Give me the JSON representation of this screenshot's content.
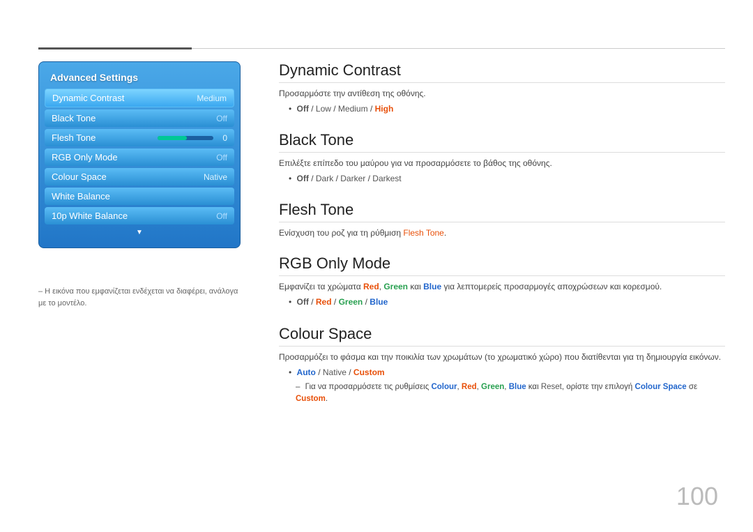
{
  "top": {
    "line_dark_label": "",
    "line_light_label": ""
  },
  "sidebar": {
    "title": "Advanced Settings",
    "items": [
      {
        "label": "Dynamic Contrast",
        "value": "Medium",
        "value_class": ""
      },
      {
        "label": "Black Tone",
        "value": "Off",
        "value_class": "off"
      },
      {
        "label": "Flesh Tone",
        "value": "0",
        "has_slider": true
      },
      {
        "label": "RGB Only Mode",
        "value": "Off",
        "value_class": "off"
      },
      {
        "label": "Colour Space",
        "value": "Native",
        "value_class": ""
      },
      {
        "label": "White Balance",
        "value": "",
        "value_class": ""
      },
      {
        "label": "10p White Balance",
        "value": "Off",
        "value_class": "off"
      }
    ],
    "arrow": "▼",
    "note": "– Η εικόνα που εμφανίζεται ενδέχεται να διαφέρει, ανάλογα με το μοντέλο."
  },
  "sections": [
    {
      "id": "dynamic-contrast",
      "title": "Dynamic Contrast",
      "desc": "Προσαρμόστε την αντίθεση της οθόνης.",
      "options": "Off / Low / Medium / High",
      "option_parts": [
        "Off",
        "/",
        "Low",
        "/",
        "Medium",
        "/",
        "High"
      ],
      "option_colors": [
        "off",
        "sep",
        "low",
        "sep",
        "medium",
        "sep",
        "high"
      ]
    },
    {
      "id": "black-tone",
      "title": "Black Tone",
      "desc": "Επιλέξτε επίπεδο του μαύρου για να προσαρμόσετε το βάθος της οθόνης.",
      "option_parts": [
        "Off",
        "/",
        "Dark",
        "/",
        "Darker",
        "/",
        "Darkest"
      ],
      "option_colors": [
        "off",
        "sep",
        "dark",
        "sep",
        "darker",
        "sep",
        "darkest"
      ]
    },
    {
      "id": "flesh-tone",
      "title": "Flesh Tone",
      "desc": "Ενίσχυση του ροζ για τη ρύθμιση",
      "desc_highlight": "Flesh Tone",
      "desc_end": ".",
      "option_parts": [],
      "option_colors": []
    },
    {
      "id": "rgb-only-mode",
      "title": "RGB Only Mode",
      "desc": "Εμφανίζει τα χρώματα",
      "desc_r": "Red",
      "desc_sep1": ",",
      "desc_g": "Green",
      "desc_sep2": "και",
      "desc_b": "Blue",
      "desc_rest": "για λεπτομερείς προσαρμογές αποχρώσεων και κορεσμού.",
      "option_parts": [
        "Off",
        "/",
        "Red",
        "/",
        "Green",
        "/",
        "Blue"
      ],
      "option_colors": [
        "off",
        "sep",
        "red",
        "sep",
        "green",
        "sep",
        "blue"
      ]
    },
    {
      "id": "colour-space",
      "title": "Colour Space",
      "desc": "Προσαρμόζει το φάσμα και την ποικιλία των χρωμάτων (το χρωματικό χώρο) που διατίθενται για τη δημιουργία εικόνων.",
      "option_parts": [
        "Auto",
        "/",
        "Native",
        "/",
        "Custom"
      ],
      "option_colors": [
        "auto",
        "sep",
        "native",
        "sep",
        "custom"
      ],
      "subnote_pre": "Για να προσαρμόσετε τις ρυθμίσεις",
      "subnote_colour": "Colour",
      "subnote_sep1": ",",
      "subnote_red": "Red",
      "subnote_sep2": ",",
      "subnote_green": "Green",
      "subnote_sep3": ",",
      "subnote_blue": "Blue",
      "subnote_kai": "και",
      "subnote_reset": "Reset",
      "subnote_mid": ", ορίστε την επιλογή",
      "subnote_colour2": "Colour Space",
      "subnote_se": "σε",
      "subnote_custom": "Custom",
      "subnote_end": "."
    }
  ],
  "page_number": "100"
}
